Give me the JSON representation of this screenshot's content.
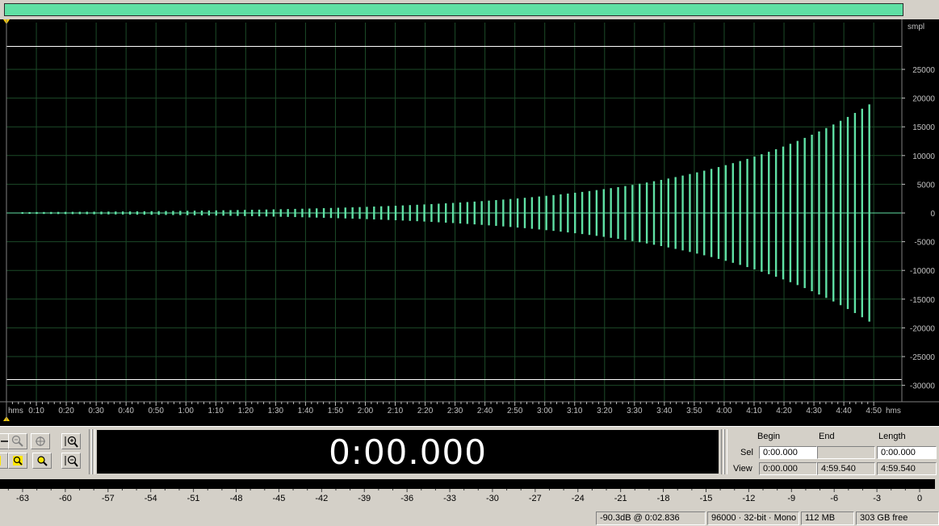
{
  "colors": {
    "waveform": "#5fe0a4",
    "grid": "#1c4a28",
    "background": "#000000",
    "ui": "#d4d0c8"
  },
  "waveform": {
    "y_unit_label": "smpl",
    "y_ticks": [
      "25000",
      "20000",
      "15000",
      "10000",
      "5000",
      "0",
      "-5000",
      "-10000",
      "-15000",
      "-20000",
      "-25000",
      "-30000"
    ],
    "x_unit_label": "hms",
    "x_ticks": [
      "0:10",
      "0:20",
      "0:30",
      "0:40",
      "0:50",
      "1:00",
      "1:10",
      "1:20",
      "1:30",
      "1:40",
      "1:50",
      "2:00",
      "2:10",
      "2:20",
      "2:30",
      "2:40",
      "2:50",
      "3:00",
      "3:10",
      "3:20",
      "3:30",
      "3:40",
      "3:50",
      "4:00",
      "4:10",
      "4:20",
      "4:30",
      "4:40",
      "4:50"
    ],
    "peak_amplitude_samples": 19500,
    "envelope": "exponential growth from near 0 at 0:05 to peak at 4:50",
    "max_limit_samples": 29000,
    "min_limit_samples": -29000
  },
  "time_display": "0:00.000",
  "selection": {
    "headers": {
      "begin": "Begin",
      "end": "End",
      "length": "Length"
    },
    "sel_label": "Sel",
    "view_label": "View",
    "sel_begin": "0:00.000",
    "sel_end": "",
    "sel_length": "0:00.000",
    "view_begin": "0:00.000",
    "view_end": "4:59.540",
    "view_length": "4:59.540"
  },
  "meter": {
    "ticks": [
      "-63",
      "-60",
      "-57",
      "-54",
      "-51",
      "-48",
      "-45",
      "-42",
      "-39",
      "-36",
      "-33",
      "-30",
      "-27",
      "-24",
      "-21",
      "-18",
      "-15",
      "-12",
      "-9",
      "-6",
      "-3",
      "0"
    ]
  },
  "status": {
    "level": "-90.3dB @  0:02.836",
    "format": "96000 · 32-bit · Mono",
    "size": "112 MB",
    "free": "303 GB free"
  },
  "icons": [
    "zoom-out-icon",
    "zoom-out-full-icon",
    "zoom-selection-icon",
    "zoom-in-vertical-icon",
    "zoom-left-icon",
    "zoom-right-icon",
    "zoom-in-icon",
    "zoom-out-vertical-icon"
  ]
}
